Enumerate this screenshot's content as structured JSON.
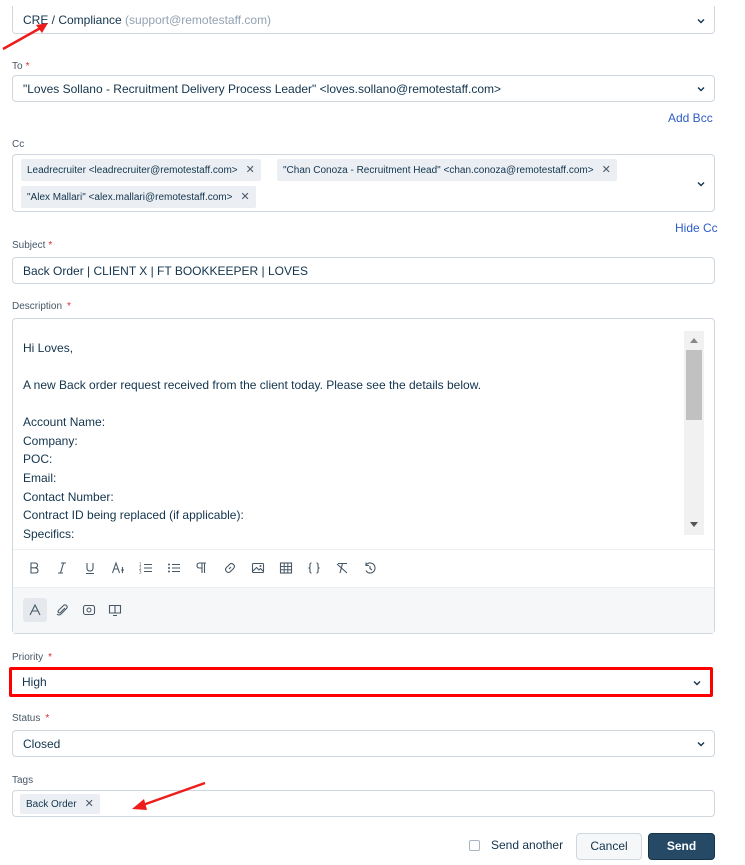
{
  "from": {
    "name": "CRE / Compliance",
    "email": "(support@remotestaff.com)"
  },
  "to": {
    "label": "To",
    "value": "\"Loves Sollano - Recruitment Delivery Process Leader\" <loves.sollano@remotestaff.com>"
  },
  "add_bcc": "Add Bcc",
  "cc": {
    "label": "Cc",
    "chips": [
      "Leadrecruiter <leadrecruiter@remotestaff.com>",
      "\"Chan Conoza - Recruitment Head\" <chan.conoza@remotestaff.com>",
      "\"Alex Mallari\" <alex.mallari@remotestaff.com>"
    ],
    "hide_cc": "Hide Cc"
  },
  "subject": {
    "label": "Subject",
    "value": "Back Order | CLIENT X | FT BOOKKEEPER | LOVES"
  },
  "description": {
    "label": "Description",
    "lines": [
      "Hi Loves,",
      "A new Back order request received from the client today. Please see the details below.",
      "Account Name:",
      "Company:",
      "POC:",
      "Email:",
      "Contact Number:",
      "Contract ID being replaced (if applicable):",
      "Specifics:"
    ],
    "toolbar_icons": [
      "bold-icon",
      "italic-icon",
      "underline-icon",
      "font-size-icon",
      "ordered-list-icon",
      "unordered-list-icon",
      "paragraph-icon",
      "link-icon",
      "image-icon",
      "table-icon",
      "code-icon",
      "clear-format-icon",
      "undo-icon"
    ],
    "bottom_icons": [
      "text-format-icon",
      "attachment-icon",
      "canned-response-icon",
      "solution-icon"
    ]
  },
  "priority": {
    "label": "Priority",
    "value": "High"
  },
  "status": {
    "label": "Status",
    "value": "Closed"
  },
  "tags": {
    "label": "Tags",
    "chips": [
      "Back Order"
    ]
  },
  "footer": {
    "send_another": "Send another",
    "cancel": "Cancel",
    "send": "Send"
  },
  "colors": {
    "primary": "#264966",
    "highlight": "#ff0000",
    "link": "#2c5cc5",
    "required": "#d72d30"
  }
}
